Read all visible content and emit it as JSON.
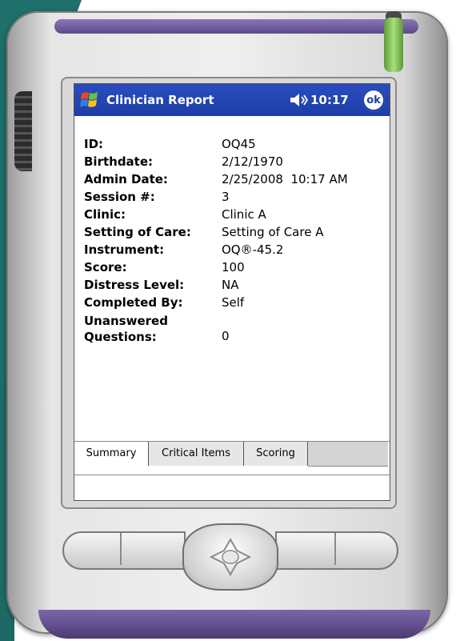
{
  "window": {
    "app_title": "Clinician Report",
    "time": "10:17",
    "ok_label": "ok"
  },
  "report": {
    "fields": [
      {
        "label": "ID:",
        "value": "OQ45"
      },
      {
        "label": "Birthdate:",
        "value": "2/12/1970"
      },
      {
        "label": "Admin Date:",
        "value": "2/25/2008  10:17 AM"
      },
      {
        "label": "Session #:",
        "value": "3"
      },
      {
        "label": "Clinic:",
        "value": "Clinic A"
      },
      {
        "label": "Setting of Care:",
        "value": "Setting of Care A"
      },
      {
        "label": "Instrument:",
        "value": "OQ®-45.2"
      },
      {
        "label": "Score:",
        "value": "100"
      },
      {
        "label": "Distress Level:",
        "value": "NA"
      },
      {
        "label": "Completed By:",
        "value": "Self"
      },
      {
        "label": "Unanswered Questions:",
        "value": "0"
      }
    ]
  },
  "tabs": [
    {
      "label": "Summary",
      "active": true
    },
    {
      "label": "Critical Items",
      "active": false
    },
    {
      "label": "Scoring",
      "active": false
    }
  ],
  "colors": {
    "titlebar": "#1d3ea6",
    "device_accent": "#5d4a8a",
    "stylus": "#a8e07a"
  }
}
